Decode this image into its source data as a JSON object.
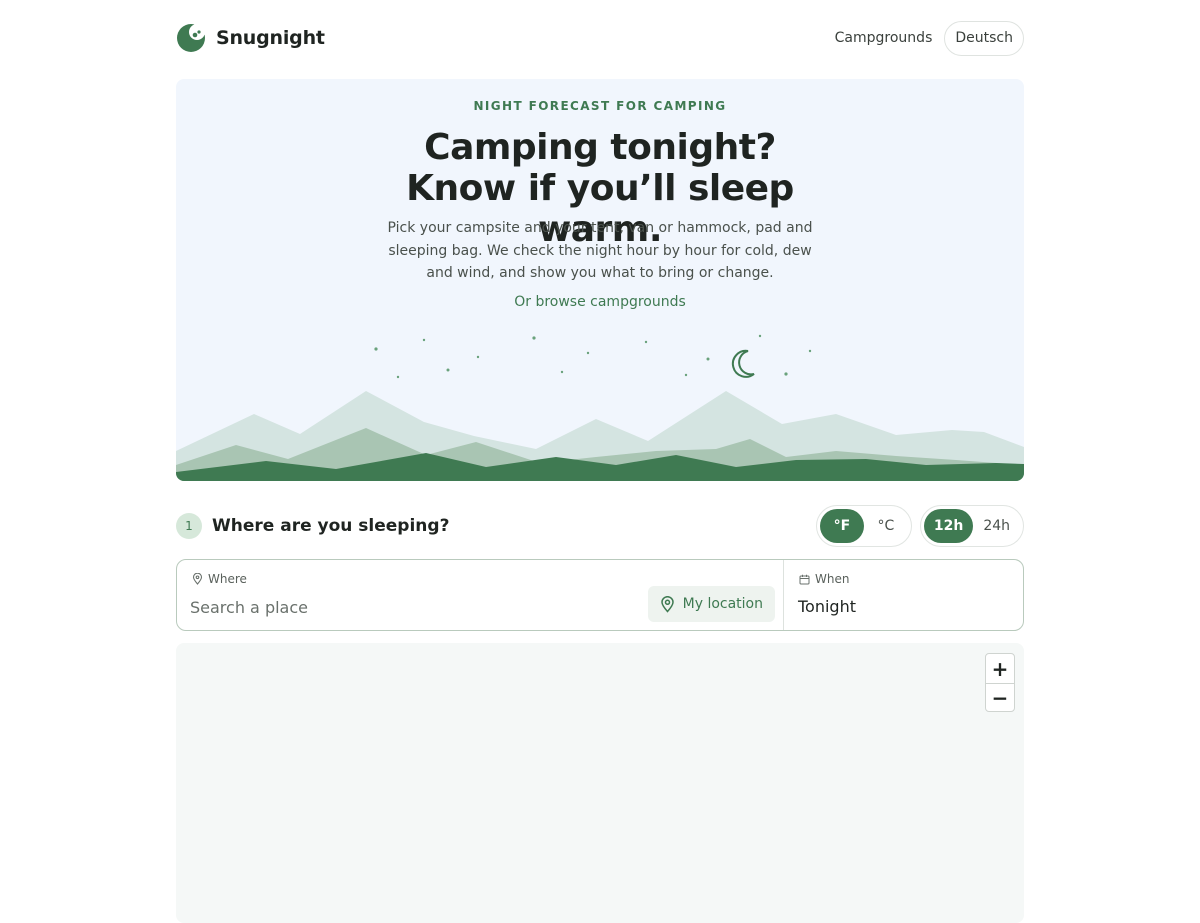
{
  "brand": {
    "name": "Snugnight",
    "logo_icon": "moon-leaf-logo"
  },
  "nav": {
    "campgrounds": "Campgrounds",
    "language": "Deutsch"
  },
  "hero": {
    "eyebrow": "NIGHT FORECAST FOR CAMPING",
    "title": "Camping tonight? Know if you’ll sleep warm.",
    "subtitle": "Pick your campsite and your tent, van or hammock, pad and sleeping bag. We check the night hour by hour for cold, dew and wind, and show you what to bring or change.",
    "browse_link": "Or browse campgrounds"
  },
  "step": {
    "number": "1",
    "title": "Where are you sleeping?"
  },
  "units": {
    "options": [
      "°F",
      "°C"
    ],
    "selected": "°F"
  },
  "clock": {
    "options": [
      "12h",
      "24h"
    ],
    "selected": "12h"
  },
  "search": {
    "where_label": "Where",
    "where_placeholder": "Search a place",
    "my_location": "My location",
    "when_label": "When",
    "when_value": "Tonight"
  },
  "map": {
    "zoom_in": "+",
    "zoom_out": "−"
  },
  "colors": {
    "accent": "#3f7a52",
    "hero_bg": "#f1f6fd",
    "mountain_light": "#d4e4e1",
    "mountain_mid": "#a9c5b3",
    "mountain_dark": "#3f7a52"
  }
}
